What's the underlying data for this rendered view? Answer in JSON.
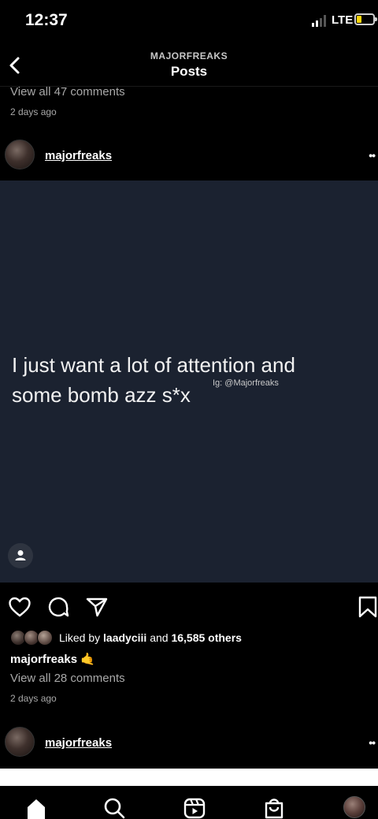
{
  "status_bar": {
    "time": "12:37",
    "network": "LTE"
  },
  "nav": {
    "account": "MAJORFREAKS",
    "title": "Posts"
  },
  "previous_post": {
    "view_comments": "View all 47 comments",
    "time_ago": "2 days ago"
  },
  "post": {
    "username": "majorfreaks",
    "more": "••",
    "image_text": "I just want a lot of attention and some bomb azz s*x",
    "watermark": "Ig: @Majorfreaks",
    "liked_prefix": "Liked by ",
    "liked_by": "laadyciii",
    "liked_and": " and ",
    "liked_others": "16,585 others",
    "caption_user": "majorfreaks",
    "caption_emoji": "🤙",
    "view_comments": "View all 28 comments",
    "time_ago": "2 days ago"
  },
  "next_post": {
    "username": "majorfreaks",
    "more": "••"
  },
  "icons": {
    "back": "chevron-left-icon",
    "like": "heart-icon",
    "comment": "comment-icon",
    "share": "paper-plane-icon",
    "save": "bookmark-icon",
    "tag": "person-icon",
    "tabs": [
      "home-icon",
      "search-icon",
      "reels-icon",
      "shop-icon",
      "profile-avatar"
    ]
  },
  "colors": {
    "background": "#000000",
    "post_bg": "#1b2230",
    "muted_text": "#a8a8a8",
    "battery": "#ffd60a"
  }
}
